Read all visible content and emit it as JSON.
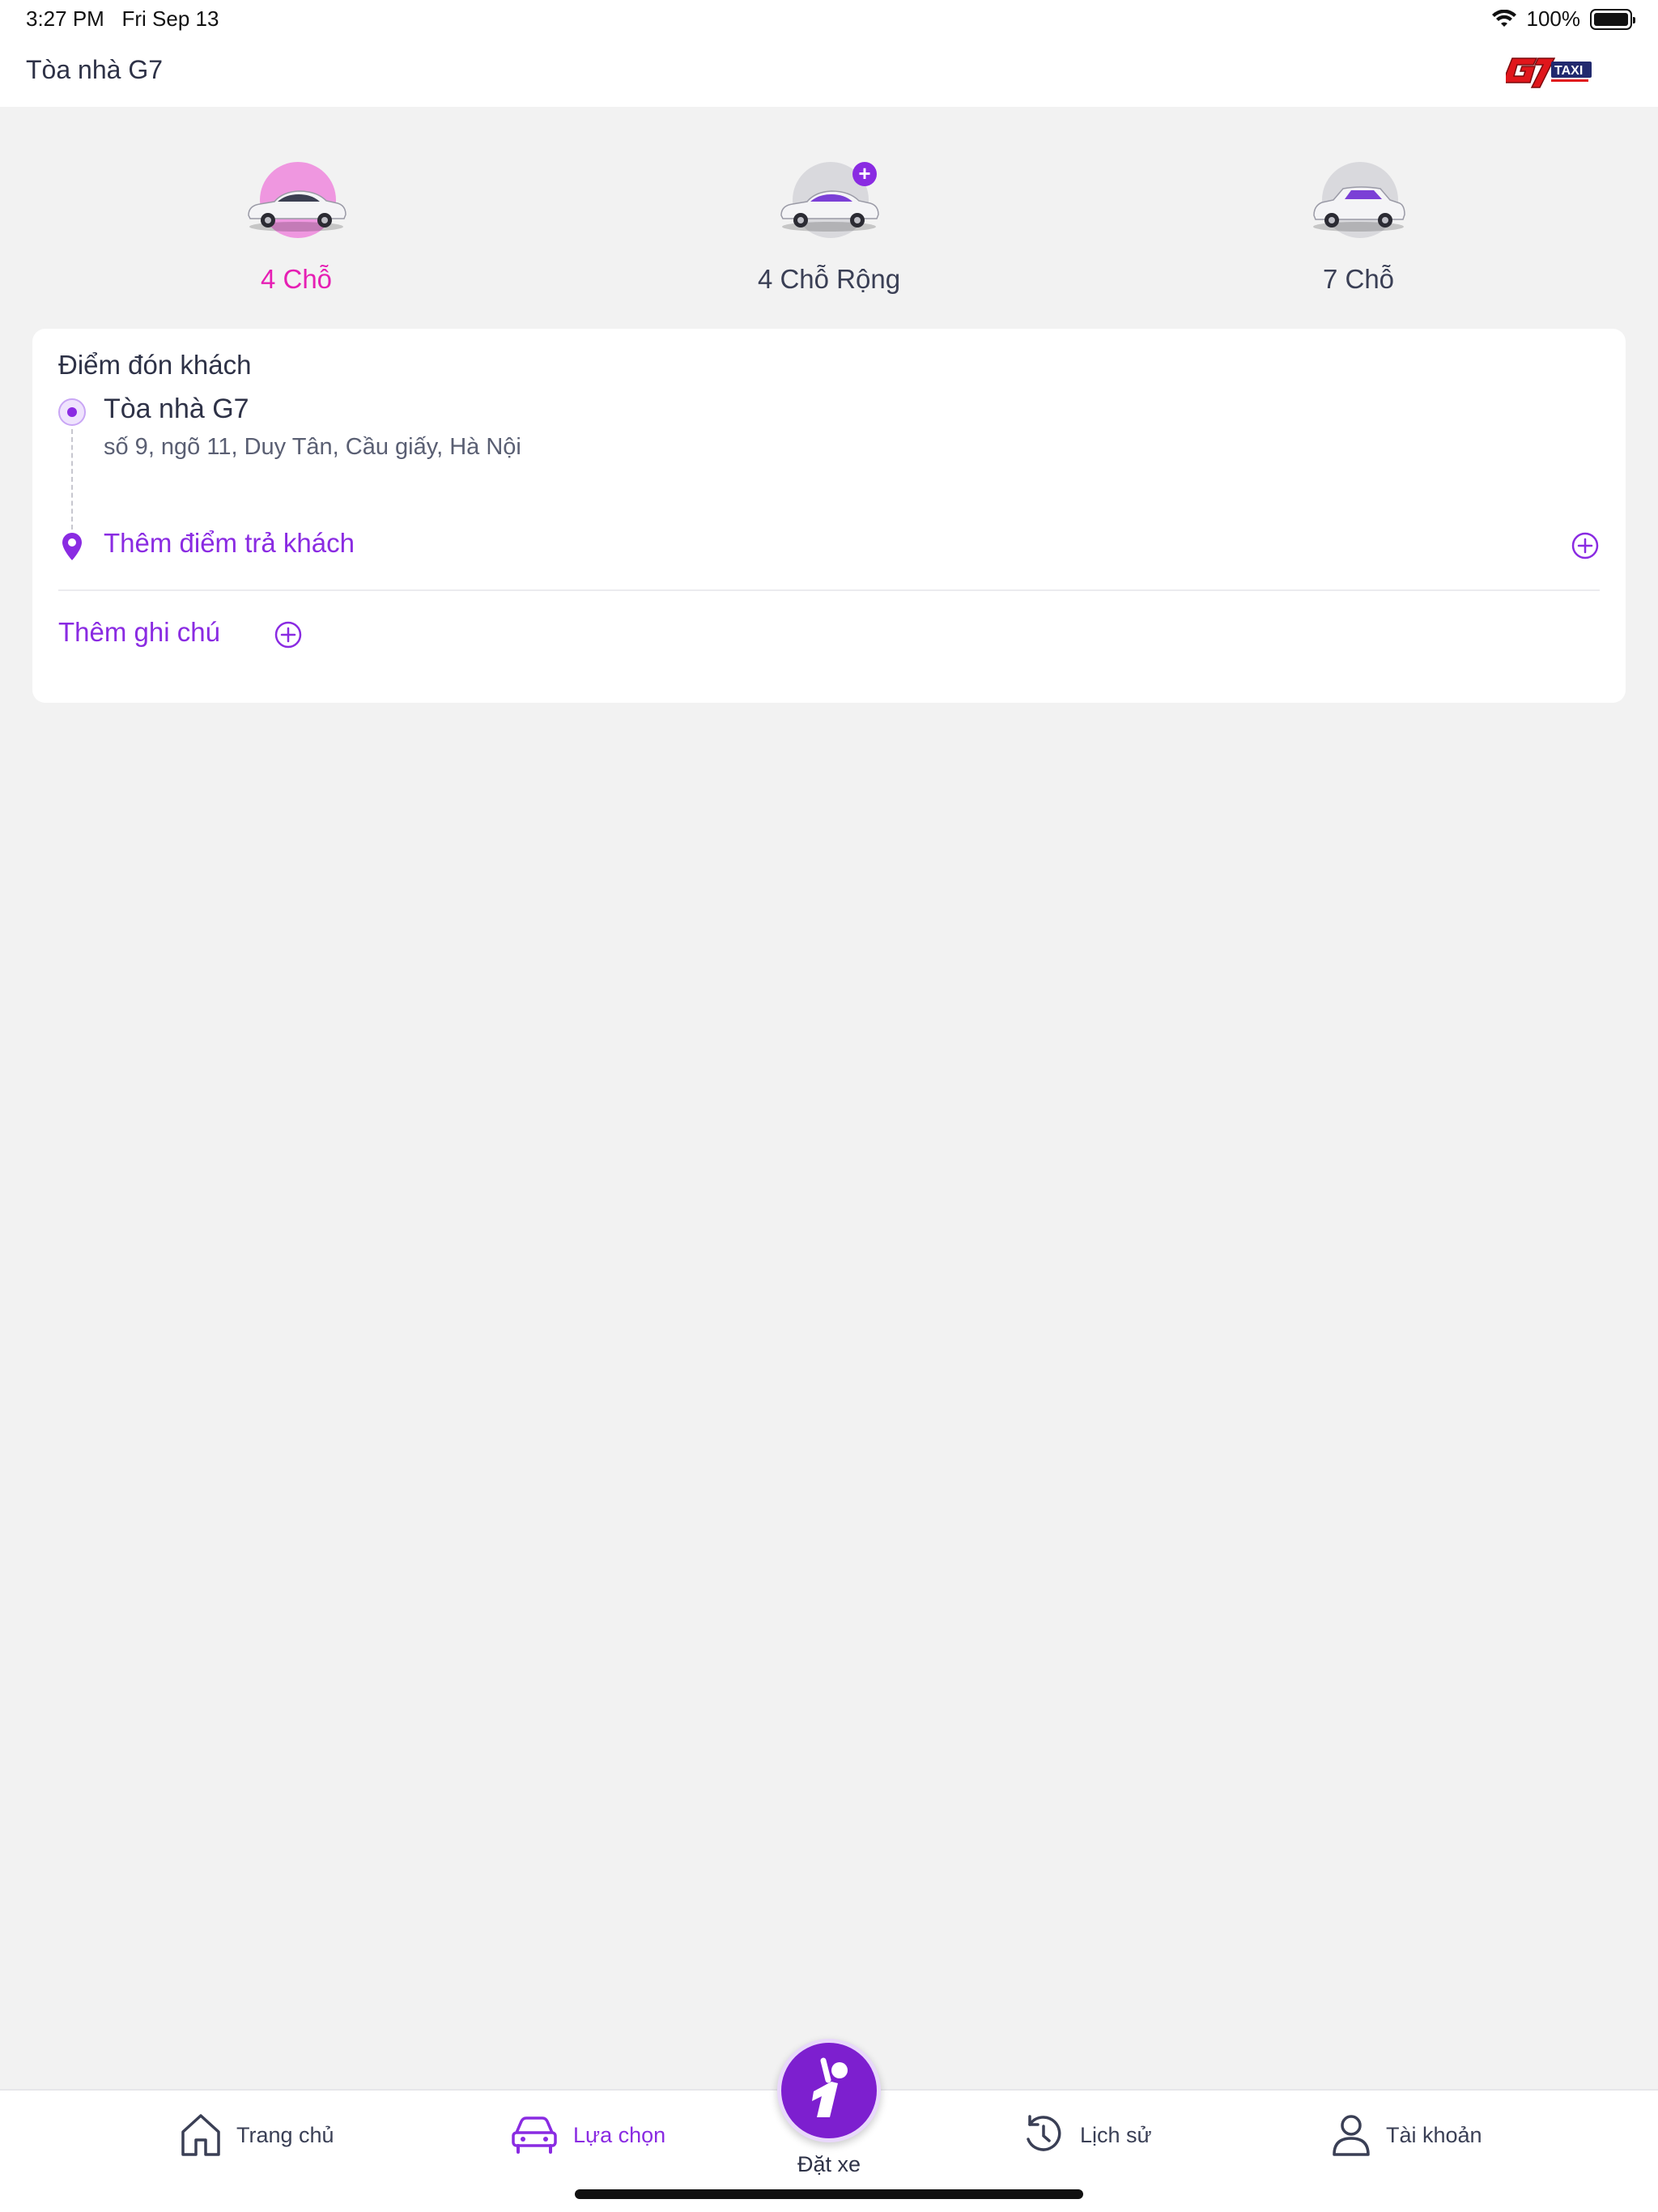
{
  "status_bar": {
    "time": "3:27 PM",
    "date": "Fri Sep 13",
    "battery": "100%"
  },
  "header": {
    "title": "Tòa nhà G7",
    "logo_icon": "g7-taxi-logo"
  },
  "vehicles": [
    {
      "label": "4 Chỗ",
      "active": true
    },
    {
      "label": "4 Chỗ Rộng",
      "active": false
    },
    {
      "label": "7 Chỗ",
      "active": false
    }
  ],
  "trip": {
    "pickup_title": "Điểm đón khách",
    "pickup_name": "Tòa nhà G7",
    "pickup_address": "số 9, ngõ 11, Duy Tân, Cầu giấy, Hà Nội",
    "dropoff_label": "Thêm điểm trả khách",
    "note_label": "Thêm ghi chú"
  },
  "tabbar": {
    "home": "Trang chủ",
    "options": "Lựa chọn",
    "book": "Đặt xe",
    "history": "Lịch sử",
    "account": "Tài khoản"
  },
  "colors": {
    "accent": "#8a2be2",
    "active_vehicle": "#e61fb4",
    "background": "#f2f2f2"
  }
}
